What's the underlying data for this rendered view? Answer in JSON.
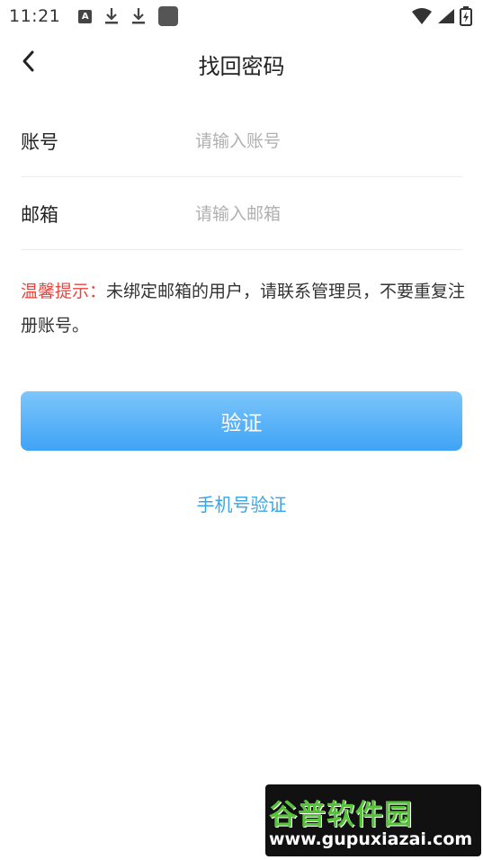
{
  "status_bar": {
    "time": "11:21",
    "icons": [
      "a-badge-icon",
      "download-icon",
      "download-icon",
      "app-square-icon",
      "wifi-icon",
      "signal-icon",
      "battery-icon"
    ],
    "badge_letter": "A"
  },
  "nav": {
    "title": "找回密码"
  },
  "form": {
    "account": {
      "label": "账号",
      "placeholder": "请输入账号",
      "value": ""
    },
    "email": {
      "label": "邮箱",
      "placeholder": "请输入邮箱",
      "value": ""
    }
  },
  "tip": {
    "prefix": "温馨提示：",
    "text": "未绑定邮箱的用户，请联系管理员，不要重复注册账号。"
  },
  "buttons": {
    "verify": "验证",
    "phone_verify": "手机号验证"
  },
  "watermark": {
    "cn": "谷普软件园",
    "en": "www.gupuxiazai.com"
  },
  "colors": {
    "accent_blue": "#3fa3f6",
    "link_blue": "#3aa5e4",
    "tip_red": "#e8463f"
  }
}
